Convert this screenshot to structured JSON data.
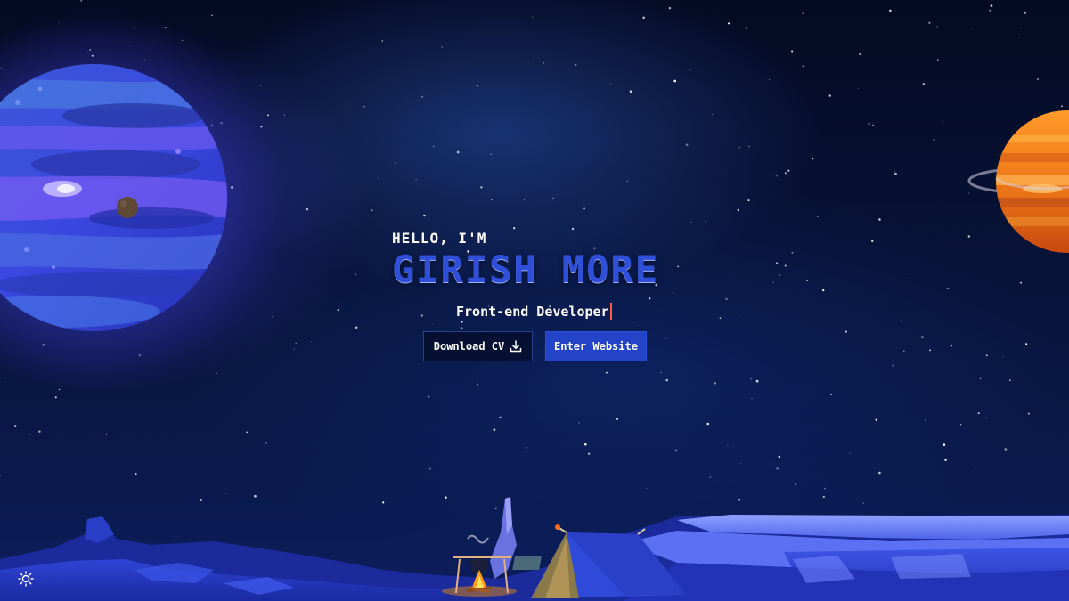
{
  "hero": {
    "greeting": "HELLO, I'M",
    "name": "GIRISH MORE",
    "role": "Front-end Developer"
  },
  "buttons": {
    "download_cv": "Download CV",
    "enter_website": "Enter Website"
  },
  "icons": {
    "download": "download-icon",
    "theme_toggle": "sun-icon"
  },
  "colors": {
    "accent": "#2344c8",
    "name": "#2f4fd8",
    "caret": "#ff5a3c",
    "background": "#050b24"
  }
}
